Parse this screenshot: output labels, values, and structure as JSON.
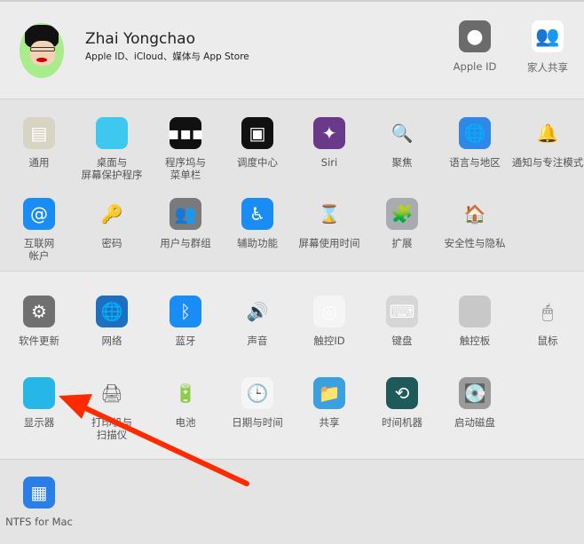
{
  "header": {
    "user_name": "Zhai Yongchao",
    "user_subtitle": "Apple ID、iCloud、媒体与 App Store",
    "apple_id": {
      "label": "Apple ID",
      "icon": "apple-icon"
    },
    "family": {
      "label": "家人共享",
      "icon": "family-icon"
    }
  },
  "sections": [
    {
      "items": [
        {
          "label": "通用",
          "icon": "general-icon",
          "bg": "#d8d4c4",
          "glyph": "▤"
        },
        {
          "label": "桌面与\n屏幕保护程序",
          "icon": "desktop-icon",
          "bg": "#3fc8ef",
          "glyph": ""
        },
        {
          "label": "程序坞与\n菜单栏",
          "icon": "dock-icon",
          "bg": "#111111",
          "glyph": "▪▪▪"
        },
        {
          "label": "调度中心",
          "icon": "mission-control-icon",
          "bg": "#111111",
          "glyph": "▣"
        },
        {
          "label": "Siri",
          "icon": "siri-icon",
          "bg": "#6a3a8a",
          "glyph": "✦"
        },
        {
          "label": "聚焦",
          "icon": "spotlight-icon",
          "bg": "transparent",
          "glyph": "🔍"
        },
        {
          "label": "语言与地区",
          "icon": "language-icon",
          "bg": "#2f87e8",
          "glyph": "🌐"
        },
        {
          "label": "通知与专注模式",
          "icon": "notifications-icon",
          "bg": "transparent",
          "glyph": "🔔"
        },
        {
          "label": "互联网\n帐户",
          "icon": "internet-accounts-icon",
          "bg": "#1a8cf5",
          "glyph": "@"
        },
        {
          "label": "密码",
          "icon": "key-icon",
          "bg": "transparent",
          "glyph": "🔑"
        },
        {
          "label": "用户与群组",
          "icon": "users-icon",
          "bg": "#7a7a7a",
          "glyph": "👥"
        },
        {
          "label": "辅助功能",
          "icon": "accessibility-icon",
          "bg": "#1a8cf5",
          "glyph": "♿"
        },
        {
          "label": "屏幕使用时间",
          "icon": "screen-time-icon",
          "bg": "transparent",
          "glyph": "⌛"
        },
        {
          "label": "扩展",
          "icon": "extensions-icon",
          "bg": "#a8acb0",
          "glyph": "🧩"
        },
        {
          "label": "安全性与隐私",
          "icon": "security-icon",
          "bg": "transparent",
          "glyph": "🏠"
        }
      ]
    },
    {
      "items": [
        {
          "label": "软件更新",
          "icon": "software-update-icon",
          "bg": "#707070",
          "glyph": "⚙"
        },
        {
          "label": "网络",
          "icon": "network-icon",
          "bg": "#1e6fc0",
          "glyph": "🌐"
        },
        {
          "label": "蓝牙",
          "icon": "bluetooth-icon",
          "bg": "#1a8cf5",
          "glyph": "ᛒ"
        },
        {
          "label": "声音",
          "icon": "sound-icon",
          "bg": "transparent",
          "glyph": "🔊"
        },
        {
          "label": "触控ID",
          "icon": "touch-id-icon",
          "bg": "#f5f5f5",
          "glyph": "◎"
        },
        {
          "label": "键盘",
          "icon": "keyboard-icon",
          "bg": "#d6d6d6",
          "glyph": "⌨"
        },
        {
          "label": "触控板",
          "icon": "trackpad-icon",
          "bg": "#c8c8c8",
          "glyph": ""
        },
        {
          "label": "鼠标",
          "icon": "mouse-icon",
          "bg": "transparent",
          "glyph": "🖱"
        },
        {
          "label": "显示器",
          "icon": "display-icon",
          "bg": "#27b6e8",
          "glyph": ""
        },
        {
          "label": "打印机与\n扫描仪",
          "icon": "printer-icon",
          "bg": "transparent",
          "glyph": "🖨"
        },
        {
          "label": "电池",
          "icon": "battery-icon",
          "bg": "transparent",
          "glyph": "🔋"
        },
        {
          "label": "日期与时间",
          "icon": "date-time-icon",
          "bg": "#f5f5f5",
          "glyph": "🕒"
        },
        {
          "label": "共享",
          "icon": "sharing-icon",
          "bg": "#3aa0e0",
          "glyph": "📁"
        },
        {
          "label": "时间机器",
          "icon": "time-machine-icon",
          "bg": "#1f5a5a",
          "glyph": "⟲"
        },
        {
          "label": "启动磁盘",
          "icon": "startup-disk-icon",
          "bg": "#9a9a9a",
          "glyph": "💽"
        }
      ]
    },
    {
      "items": [
        {
          "label": "NTFS for Mac",
          "icon": "ntfs-icon",
          "bg": "#2a7ee8",
          "glyph": "▦"
        }
      ]
    }
  ],
  "colors": {
    "arrow": "#ff2a00",
    "accent": "#1a8cf5"
  }
}
